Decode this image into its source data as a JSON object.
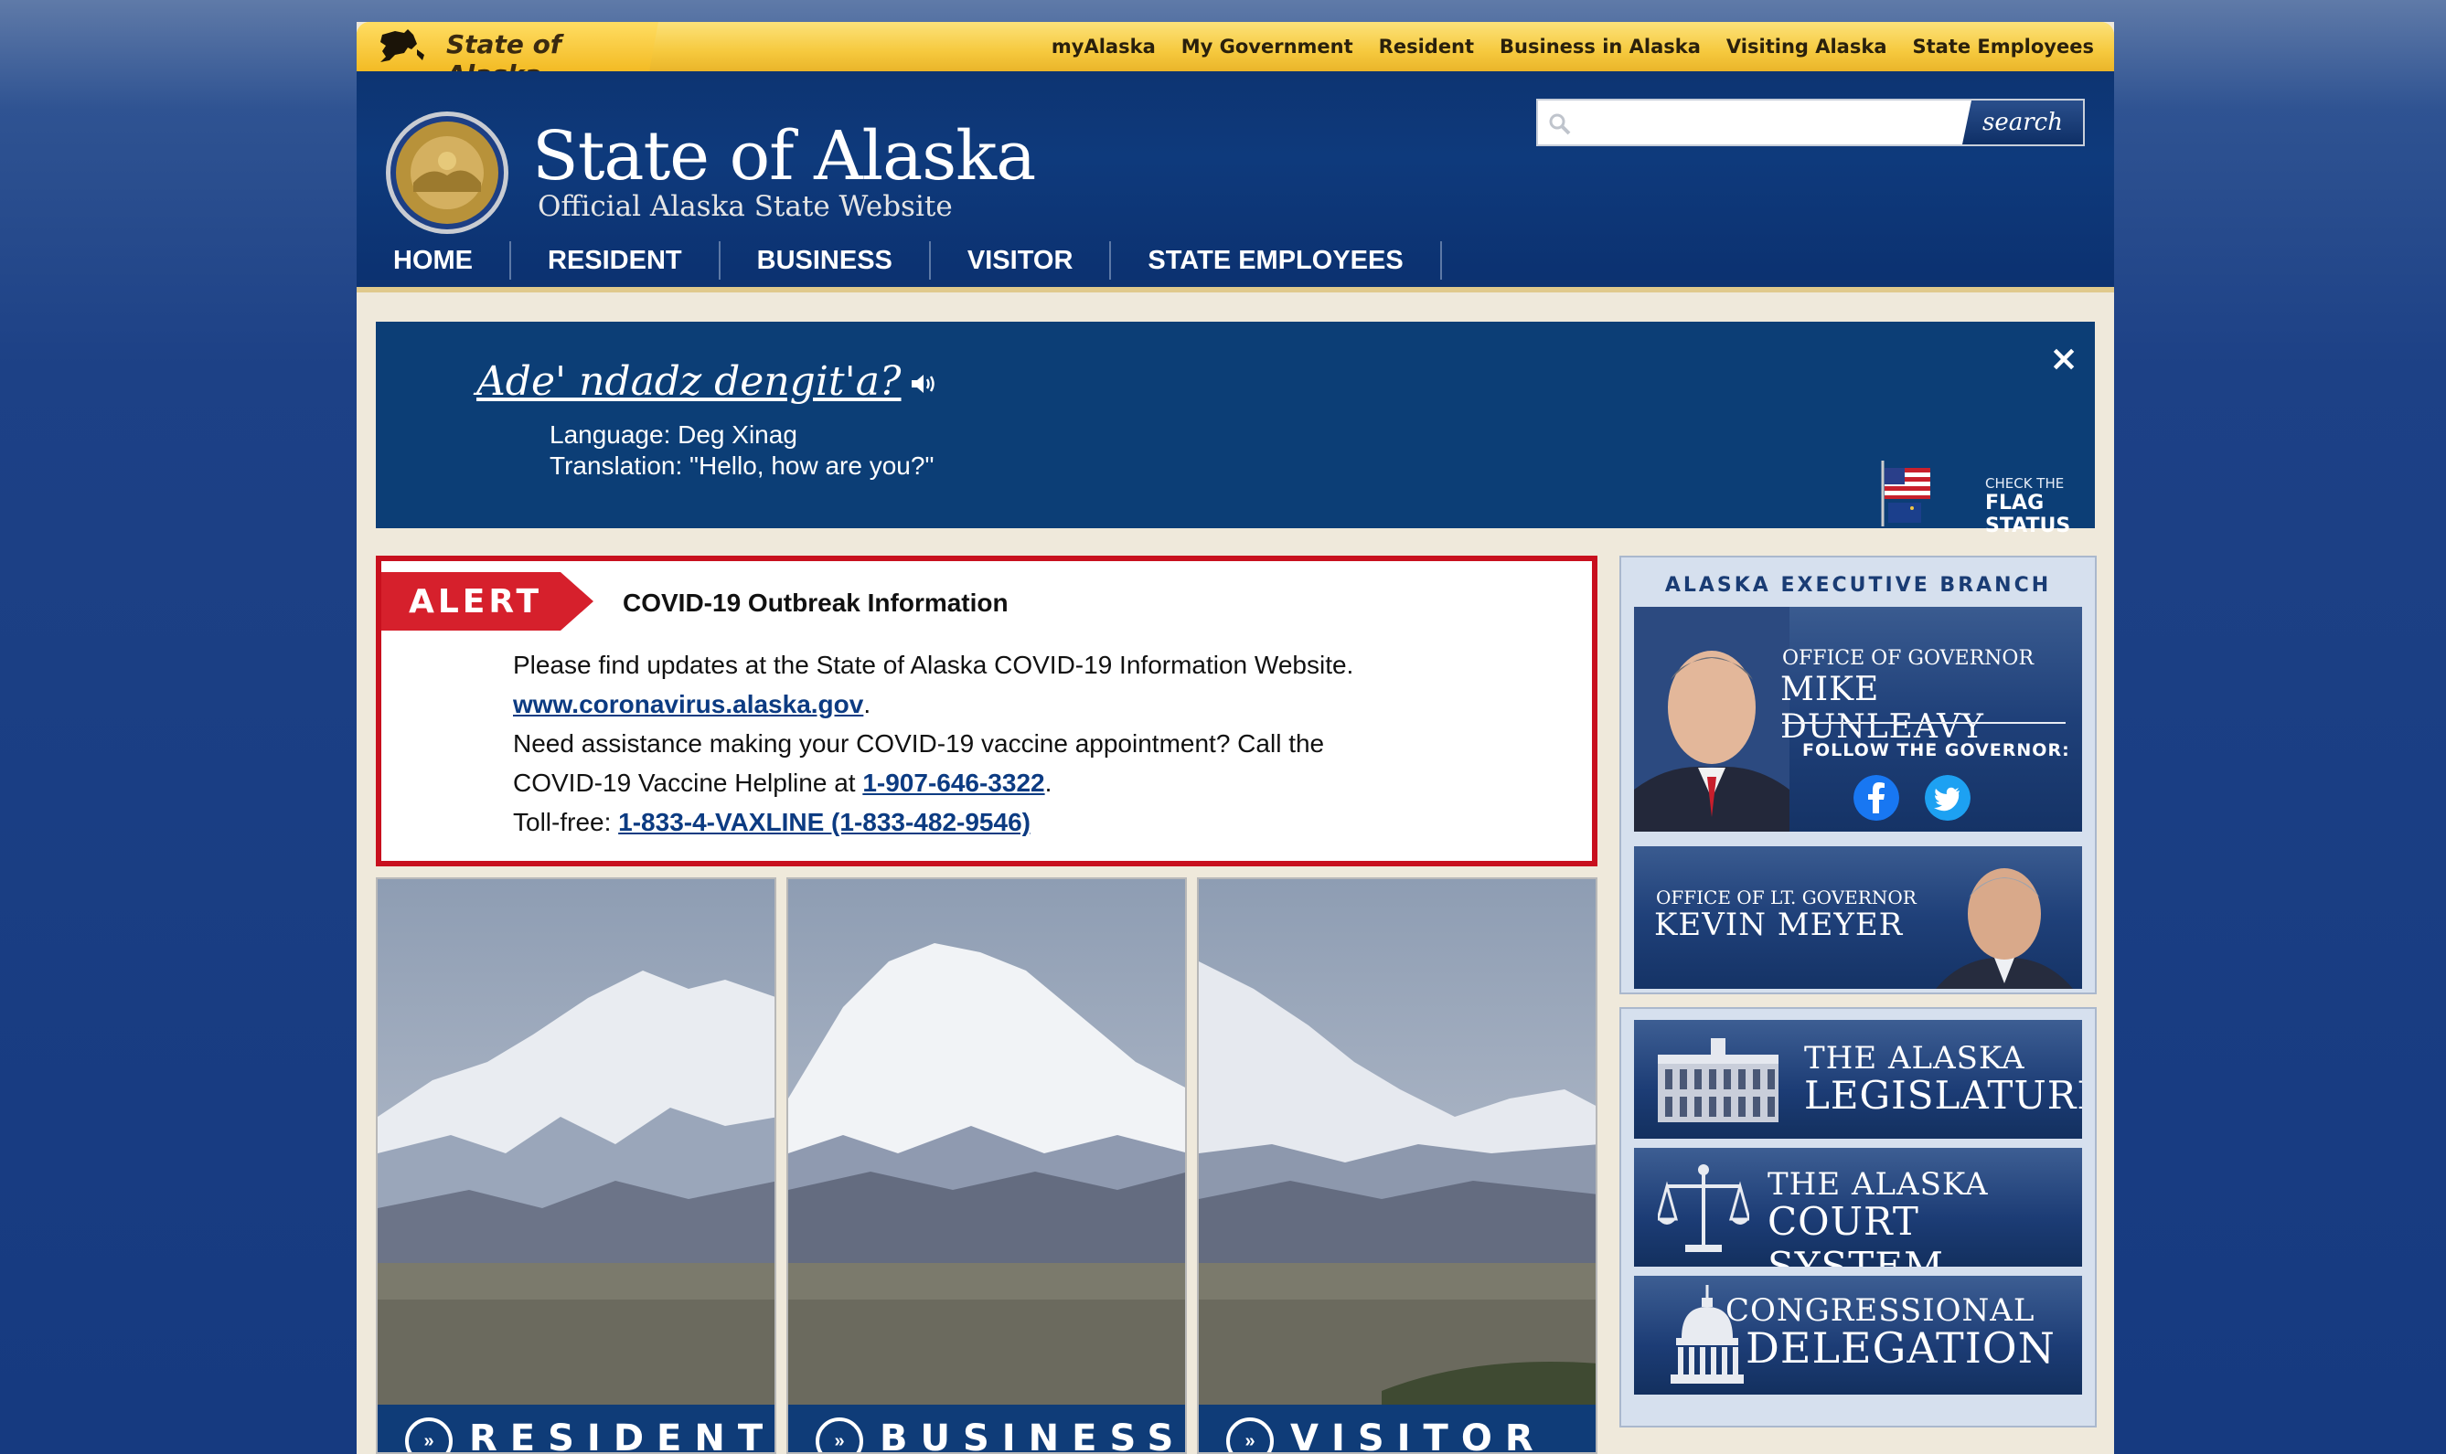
{
  "topbar": {
    "brand": "State of Alaska",
    "links": [
      "myAlaska",
      "My Government",
      "Resident",
      "Business in Alaska",
      "Visiting Alaska",
      "State Employees"
    ]
  },
  "header": {
    "title": "State of Alaska",
    "subtitle": "Official Alaska State Website",
    "search": {
      "placeholder": "",
      "button": "search"
    }
  },
  "nav": {
    "items": [
      "HOME",
      "RESIDENT",
      "BUSINESS",
      "VISITOR",
      "STATE EMPLOYEES"
    ]
  },
  "banner": {
    "phrase": "Ade' ndadz dengit'a?",
    "language": "Language: Deg Xinag",
    "translation": "Translation: \"Hello, how are you?\"",
    "close": "×",
    "flag_small": "CHECK THE",
    "flag_big": "FLAG STATUS"
  },
  "alert": {
    "tag": "ALERT",
    "title": "COVID-19 Outbreak Information",
    "line1": "Please find updates at the State of Alaska COVID-19 Information Website.",
    "link1": "www.coronavirus.alaska.gov",
    "line1_end": ".",
    "line2": "Need assistance making your COVID-19 vaccine appointment? Call the",
    "line3": "COVID-19 Vaccine Helpline at ",
    "phone1": "1-907-646-3322",
    "line3_end": ".",
    "line4": "Toll-free: ",
    "phone2": "1-833-4-VAXLINE (1-833-482-9546)"
  },
  "tiles": [
    "RESIDENT",
    "BUSINESS",
    "VISITOR"
  ],
  "executive": {
    "title": "ALASKA EXECUTIVE BRANCH",
    "gov_small": "OFFICE OF GOVERNOR",
    "gov_name": "MIKE DUNLEAVY",
    "follow": "FOLLOW THE GOVERNOR:",
    "lt_small": "OFFICE OF LT. GOVERNOR",
    "lt_name": "KEVIN MEYER"
  },
  "branches": [
    {
      "line1": "THE ALASKA",
      "line2": "LEGISLATURE"
    },
    {
      "line1": "THE ALASKA",
      "line2": "COURT SYSTEM"
    },
    {
      "line1": "CONGRESSIONAL",
      "line2": "DELEGATION"
    }
  ],
  "colors": {
    "page_bg": "#1d4186",
    "header_navy": "#0e3a7c",
    "gold_bar": "#f6c93e",
    "alert_red": "#c8101e",
    "link_blue": "#0c3b82"
  }
}
